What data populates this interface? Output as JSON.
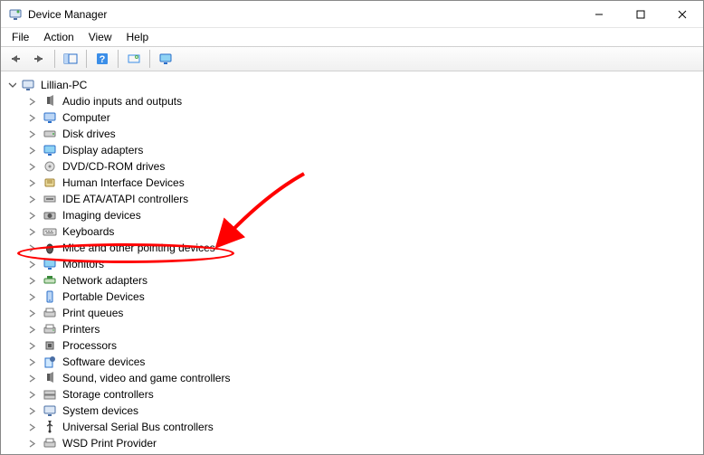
{
  "window": {
    "title": "Device Manager"
  },
  "menu": {
    "file": "File",
    "action": "Action",
    "view": "View",
    "help": "Help"
  },
  "tree": {
    "root": "Lillian-PC",
    "nodes": [
      {
        "label": "Audio inputs and outputs",
        "icon": "audio"
      },
      {
        "label": "Computer",
        "icon": "computer"
      },
      {
        "label": "Disk drives",
        "icon": "disk"
      },
      {
        "label": "Display adapters",
        "icon": "display"
      },
      {
        "label": "DVD/CD-ROM drives",
        "icon": "optical"
      },
      {
        "label": "Human Interface Devices",
        "icon": "hid"
      },
      {
        "label": "IDE ATA/ATAPI controllers",
        "icon": "ide"
      },
      {
        "label": "Imaging devices",
        "icon": "imaging"
      },
      {
        "label": "Keyboards",
        "icon": "keyboard"
      },
      {
        "label": "Mice and other pointing devices",
        "icon": "mouse",
        "highlighted": true
      },
      {
        "label": "Monitors",
        "icon": "monitor"
      },
      {
        "label": "Network adapters",
        "icon": "network"
      },
      {
        "label": "Portable Devices",
        "icon": "portable"
      },
      {
        "label": "Print queues",
        "icon": "printqueue"
      },
      {
        "label": "Printers",
        "icon": "printer"
      },
      {
        "label": "Processors",
        "icon": "cpu"
      },
      {
        "label": "Software devices",
        "icon": "software"
      },
      {
        "label": "Sound, video and game controllers",
        "icon": "sound"
      },
      {
        "label": "Storage controllers",
        "icon": "storage"
      },
      {
        "label": "System devices",
        "icon": "system"
      },
      {
        "label": "Universal Serial Bus controllers",
        "icon": "usb"
      },
      {
        "label": "WSD Print Provider",
        "icon": "wsd"
      }
    ]
  },
  "annotation": {
    "highlight_index": 9,
    "circle_color": "#ff0000",
    "arrow_color": "#ff0000"
  }
}
